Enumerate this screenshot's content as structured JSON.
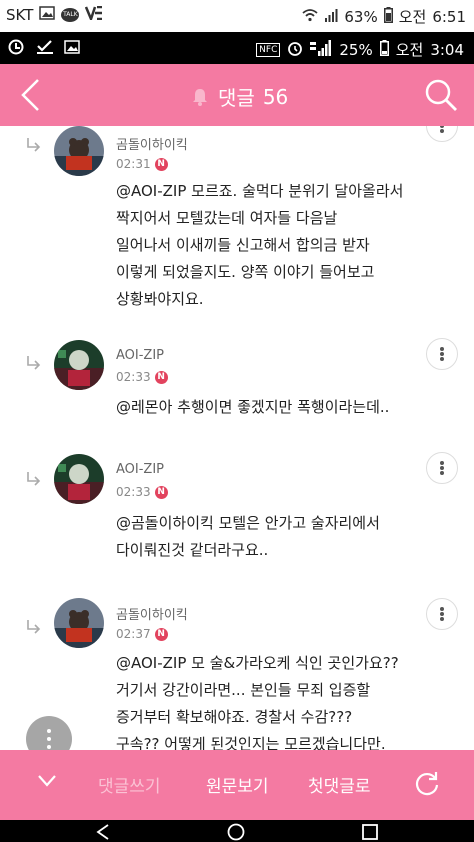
{
  "status_bar_1": {
    "carrier": "SKT",
    "talk_badge": "TALK",
    "battery": "63%",
    "ampm": "오전",
    "time": "6:51"
  },
  "status_bar_2": {
    "nfc": "NFC",
    "battery": "25%",
    "ampm": "오전",
    "time": "3:04"
  },
  "header": {
    "title": "댓글",
    "count": "56",
    "back_icon": "chevron-left-icon",
    "search_icon": "search-icon"
  },
  "comments": [
    {
      "username": "곰돌이하이킥",
      "time": "02:31",
      "new_badge": "N",
      "text": "@AOI-ZIP 모르죠. 술먹다 분위기 달아올라서\n짝지어서 모텔갔는데 여자들 다음날\n일어나서 이새끼들 신고해서 합의금 받자\n이렇게 되었을지도. 양쪽 이야기 들어보고\n상황봐야지요."
    },
    {
      "username": "AOI-ZIP",
      "time": "02:33",
      "new_badge": "N",
      "text": "@레몬아 추행이면 좋겠지만 폭행이라는데.."
    },
    {
      "username": "AOI-ZIP",
      "time": "02:33",
      "new_badge": "N",
      "text": "@곰돌이하이킥 모텔은 안가고 술자리에서\n다이뤄진것 같더라구요.."
    },
    {
      "username": "곰돌이하이킥",
      "time": "02:37",
      "new_badge": "N",
      "text": "@AOI-ZIP 모 술&가라오케 식인 곳인가요??\n거기서 강간이라면... 본인들 무죄 입증할\n증거부터 확보해야죠. 경찰서 수감???\n구속?? 어떻게 된것인지는 모르겠습니다만."
    }
  ],
  "bottom_bar": {
    "write_comment": "댓글쓰기",
    "view_original": "원문보기",
    "first_comment": "첫댓글로"
  },
  "colors": {
    "accent_pink": "#f47aa2",
    "badge_red": "#e2435e"
  }
}
